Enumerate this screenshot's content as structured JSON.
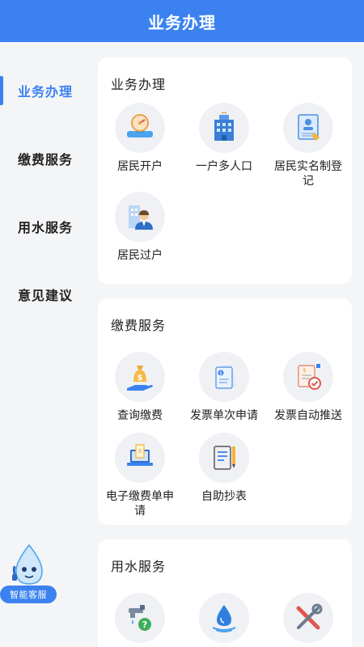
{
  "header": {
    "title": "业务办理"
  },
  "sidebar": {
    "items": [
      {
        "label": "业务办理",
        "active": true
      },
      {
        "label": "缴费服务",
        "active": false
      },
      {
        "label": "用水服务",
        "active": false
      },
      {
        "label": "意见建议",
        "active": false
      }
    ]
  },
  "sections": [
    {
      "title": "业务办理",
      "tiles": [
        {
          "label": "居民开户",
          "icon": "water-meter-icon"
        },
        {
          "label": "一户多人口",
          "icon": "building-icon"
        },
        {
          "label": "居民实名制登记",
          "icon": "id-document-icon"
        },
        {
          "label": "居民过户",
          "icon": "person-building-icon"
        }
      ]
    },
    {
      "title": "缴费服务",
      "tiles": [
        {
          "label": "查询缴费",
          "icon": "money-bag-hand-icon"
        },
        {
          "label": "发票单次申请",
          "icon": "invoice-icon"
        },
        {
          "label": "发票自动推送",
          "icon": "invoice-check-icon"
        },
        {
          "label": "电子缴费单申请",
          "icon": "laptop-bill-icon"
        },
        {
          "label": "自助抄表",
          "icon": "notepad-pencil-icon"
        }
      ]
    },
    {
      "title": "用水服务",
      "tiles": [
        {
          "icon": "faucet-question-icon"
        },
        {
          "icon": "water-drop-icon"
        },
        {
          "icon": "tools-icon"
        }
      ]
    }
  ],
  "assistant": {
    "label": "智能客服",
    "icon": "water-drop-mascot-icon"
  },
  "colors": {
    "primary": "#3b82f0",
    "background": "#f4f5f7",
    "card": "#ffffff"
  }
}
